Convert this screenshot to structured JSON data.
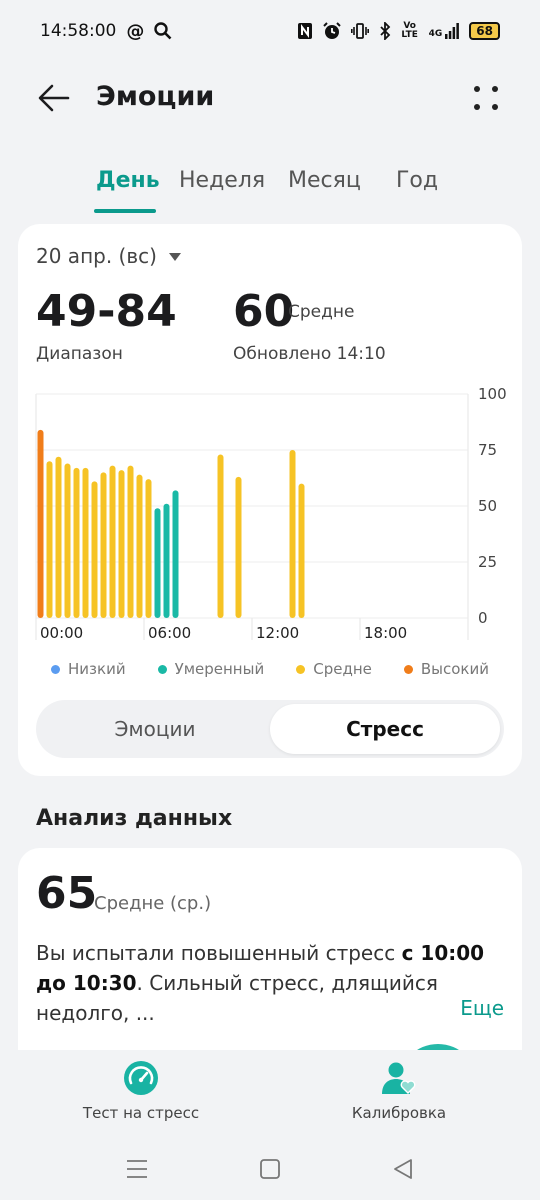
{
  "status_bar": {
    "time": "14:58:00",
    "left_icons": [
      "at-icon",
      "search-icon"
    ],
    "right_icons": [
      "nfc-icon",
      "alarm-icon",
      "vibrate-icon",
      "bluetooth-icon",
      "volte-icon",
      "signal-4g-icon"
    ],
    "volte_text": "Vo LTE",
    "network_text": "4G",
    "battery": "68"
  },
  "header": {
    "title": "Эмоции"
  },
  "tabs": [
    {
      "label": "День",
      "active": true
    },
    {
      "label": "Неделя",
      "active": false
    },
    {
      "label": "Месяц",
      "active": false
    },
    {
      "label": "Год",
      "active": false
    }
  ],
  "summary": {
    "date": "20 апр. (вс)",
    "range_value": "49-84",
    "range_label": "Диапазон",
    "avg_value": "60",
    "avg_level": "Средне",
    "updated": "Обновлено 14:10"
  },
  "colors": {
    "accent": "#0b9a8c",
    "low": "#5b9cf0",
    "moderate": "#1ab9a6",
    "medium": "#f6c325",
    "high": "#f07d1a"
  },
  "chart_data": {
    "type": "bar",
    "x_ticks": [
      "00:00",
      "06:00",
      "12:00",
      "18:00"
    ],
    "y_ticks": [
      "100",
      "75",
      "50",
      "25",
      "0"
    ],
    "ylim": [
      0,
      100
    ],
    "xlim_hours": [
      0,
      24
    ],
    "grid": true,
    "legend_position": "bottom",
    "legend": [
      {
        "name": "Низкий",
        "color": "#5b9cf0"
      },
      {
        "name": "Умеренный",
        "color": "#1ab9a6"
      },
      {
        "name": "Средне",
        "color": "#f6c325"
      },
      {
        "name": "Высокий",
        "color": "#f07d1a"
      }
    ],
    "bars": [
      {
        "hour": 0.25,
        "value": 84,
        "level": "high"
      },
      {
        "hour": 0.75,
        "value": 70,
        "level": "medium"
      },
      {
        "hour": 1.25,
        "value": 72,
        "level": "medium"
      },
      {
        "hour": 1.75,
        "value": 69,
        "level": "medium"
      },
      {
        "hour": 2.25,
        "value": 67,
        "level": "medium"
      },
      {
        "hour": 2.75,
        "value": 67,
        "level": "medium"
      },
      {
        "hour": 3.25,
        "value": 61,
        "level": "medium"
      },
      {
        "hour": 3.75,
        "value": 65,
        "level": "medium"
      },
      {
        "hour": 4.25,
        "value": 68,
        "level": "medium"
      },
      {
        "hour": 4.75,
        "value": 66,
        "level": "medium"
      },
      {
        "hour": 5.25,
        "value": 68,
        "level": "medium"
      },
      {
        "hour": 5.75,
        "value": 64,
        "level": "medium"
      },
      {
        "hour": 6.25,
        "value": 62,
        "level": "medium"
      },
      {
        "hour": 6.75,
        "value": 49,
        "level": "moderate"
      },
      {
        "hour": 7.25,
        "value": 51,
        "level": "moderate"
      },
      {
        "hour": 7.75,
        "value": 57,
        "level": "moderate"
      },
      {
        "hour": 10.25,
        "value": 73,
        "level": "medium"
      },
      {
        "hour": 11.25,
        "value": 63,
        "level": "medium"
      },
      {
        "hour": 14.25,
        "value": 75,
        "level": "medium"
      },
      {
        "hour": 14.75,
        "value": 60,
        "level": "medium"
      }
    ]
  },
  "segment": {
    "emotions": "Эмоции",
    "stress": "Стресс",
    "active": "stress"
  },
  "analysis": {
    "section_title": "Анализ данных",
    "value": "65",
    "level": "Средне",
    "avg_note": "(ср.)",
    "text_before": "Вы испытали повышенный стресс ",
    "text_bold": "с 10:00 до 10:30",
    "text_after": ". Сильный стресс, длящийся недолго, ...",
    "more": "Еще"
  },
  "bottom_actions": [
    {
      "label": "Тест на стресс",
      "icon": "gauge-icon"
    },
    {
      "label": "Калибровка",
      "icon": "person-heart-icon"
    }
  ],
  "nav": [
    "menu-icon",
    "home-icon",
    "back-triangle-icon"
  ]
}
